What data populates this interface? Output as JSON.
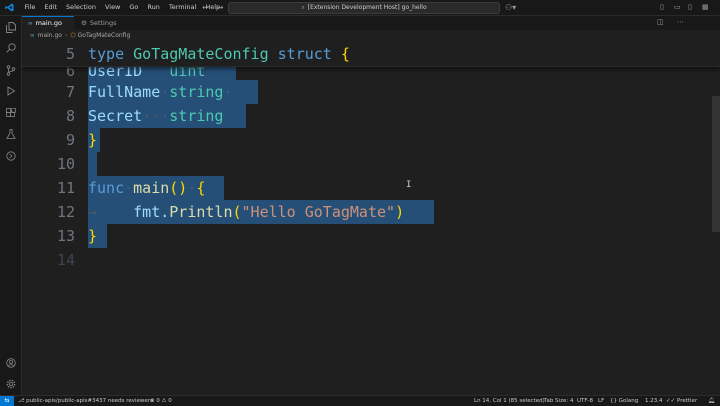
{
  "menu": [
    "File",
    "Edit",
    "Selection",
    "View",
    "Go",
    "Run",
    "Terminal",
    "Help"
  ],
  "command_center": {
    "text": "[Extension Development Host] go_hello"
  },
  "tabs": [
    {
      "label": "main.go"
    },
    {
      "label": "Settings"
    }
  ],
  "breadcrumb": {
    "file": "main.go",
    "symbol": "GoTagMateConfig"
  },
  "editor": {
    "sticky_line": {
      "number": "5",
      "code": "type GoTagMateConfig struct {"
    },
    "lines": [
      {
        "number": "6",
        "code": "UserID   uint"
      },
      {
        "number": "7",
        "code": "FullName string"
      },
      {
        "number": "8",
        "code": "Secret   string"
      },
      {
        "number": "9",
        "code": "}"
      },
      {
        "number": "10",
        "code": ""
      },
      {
        "number": "11",
        "code": "func main() {"
      },
      {
        "number": "12",
        "code": "fmt.Println(\"Hello GoTagMate\")"
      },
      {
        "number": "13",
        "code": "}"
      },
      {
        "number": "14",
        "code": ""
      }
    ]
  },
  "statusbar": {
    "remote_icon": "remote-icon",
    "pr": "public-apis/public-apis#3437 needs reviewers",
    "errors": "0",
    "warnings": "0",
    "position": "Ln 14, Col 1 (85 selected)",
    "tab_size": "Tab Size: 4",
    "encoding": "UTF-8",
    "eol": "LF",
    "language": "Golang",
    "version": "1.23.4",
    "formatter": "Prettier"
  },
  "colors": {
    "accent": "#0078d4",
    "selection": "#264f78",
    "background": "#1f1f1f"
  }
}
